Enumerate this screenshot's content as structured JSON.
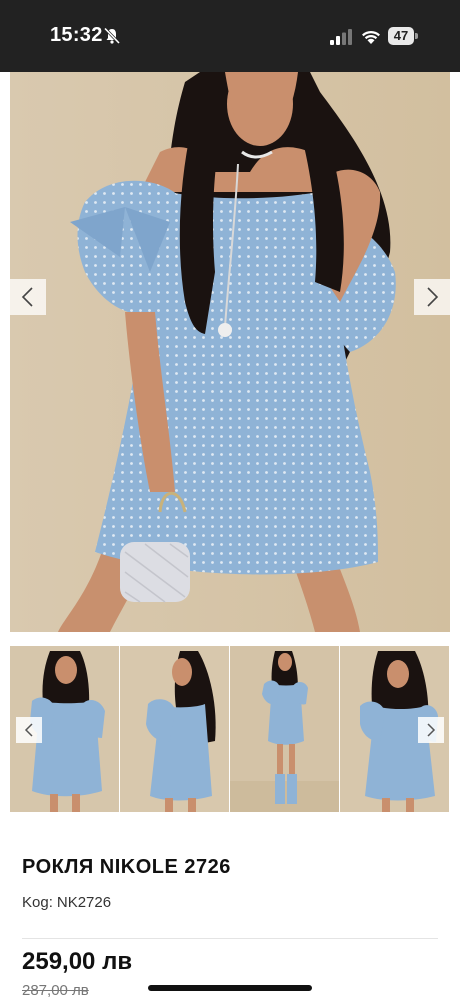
{
  "status_bar": {
    "time": "15:32",
    "battery": "47",
    "icons": [
      "bell-slash-icon",
      "signal-icon",
      "wifi-icon",
      "battery-icon"
    ]
  },
  "gallery": {
    "main_image": "model wearing blue off-shoulder eyelet dress",
    "thumbnails": [
      "front view",
      "side view",
      "full length view",
      "front view with hair"
    ],
    "prev_icon": "chevron-left-icon",
    "next_icon": "chevron-right-icon"
  },
  "product": {
    "title": "РОКЛЯ NIKOLE 2726",
    "code_label": "Kog:",
    "code_value": "NK2726",
    "price": "259,00 лв",
    "old_price": "287,00 лв"
  },
  "colors": {
    "dress": "#8fb3d6",
    "background": "#d8c8ae",
    "status_bar": "#222222"
  }
}
